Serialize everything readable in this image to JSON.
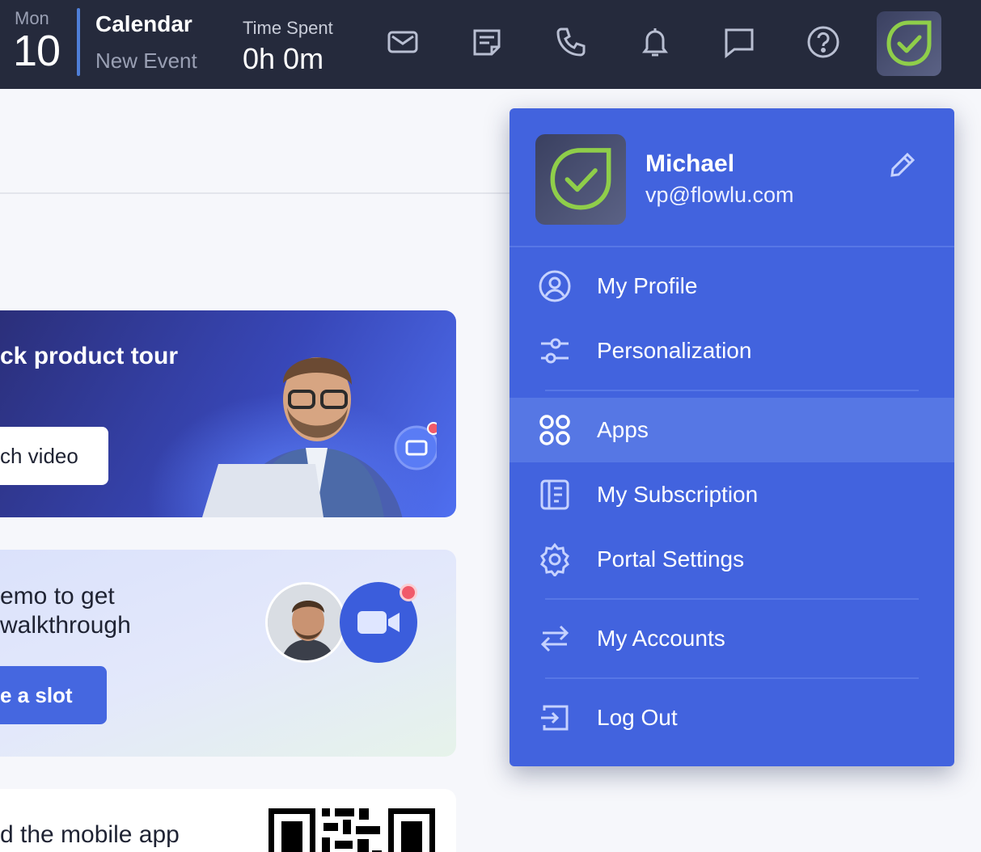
{
  "topbar": {
    "day_name": "Mon",
    "day_number": "10",
    "calendar_title": "Calendar",
    "calendar_subtitle": "New Event",
    "time_label": "Time Spent",
    "time_value": "0h 0m",
    "icons": [
      "mail-icon",
      "notes-icon",
      "phone-icon",
      "bell-icon",
      "chat-icon",
      "help-icon"
    ]
  },
  "cards": {
    "tour_title": "ck product tour",
    "tour_button": "ch video",
    "demo_title_line1": "emo to get",
    "demo_title_line2": "walkthrough",
    "demo_button": "e a slot",
    "app_title": "d the mobile app"
  },
  "menu": {
    "user_name": "Michael",
    "user_email": "vp@flowlu.com",
    "items": [
      {
        "label": "My Profile",
        "icon": "user-circle-icon"
      },
      {
        "label": "Personalization",
        "icon": "sliders-icon"
      },
      {
        "label": "Apps",
        "icon": "apps-grid-icon",
        "active": true
      },
      {
        "label": "My Subscription",
        "icon": "subscription-icon"
      },
      {
        "label": "Portal Settings",
        "icon": "gear-icon"
      },
      {
        "label": "My Accounts",
        "icon": "switch-arrows-icon"
      },
      {
        "label": "Log Out",
        "icon": "logout-icon"
      }
    ]
  },
  "colors": {
    "topbar_bg": "#252a3c",
    "menu_bg": "#4263de",
    "menu_active": "#5677e4",
    "accent": "#4567e0"
  }
}
